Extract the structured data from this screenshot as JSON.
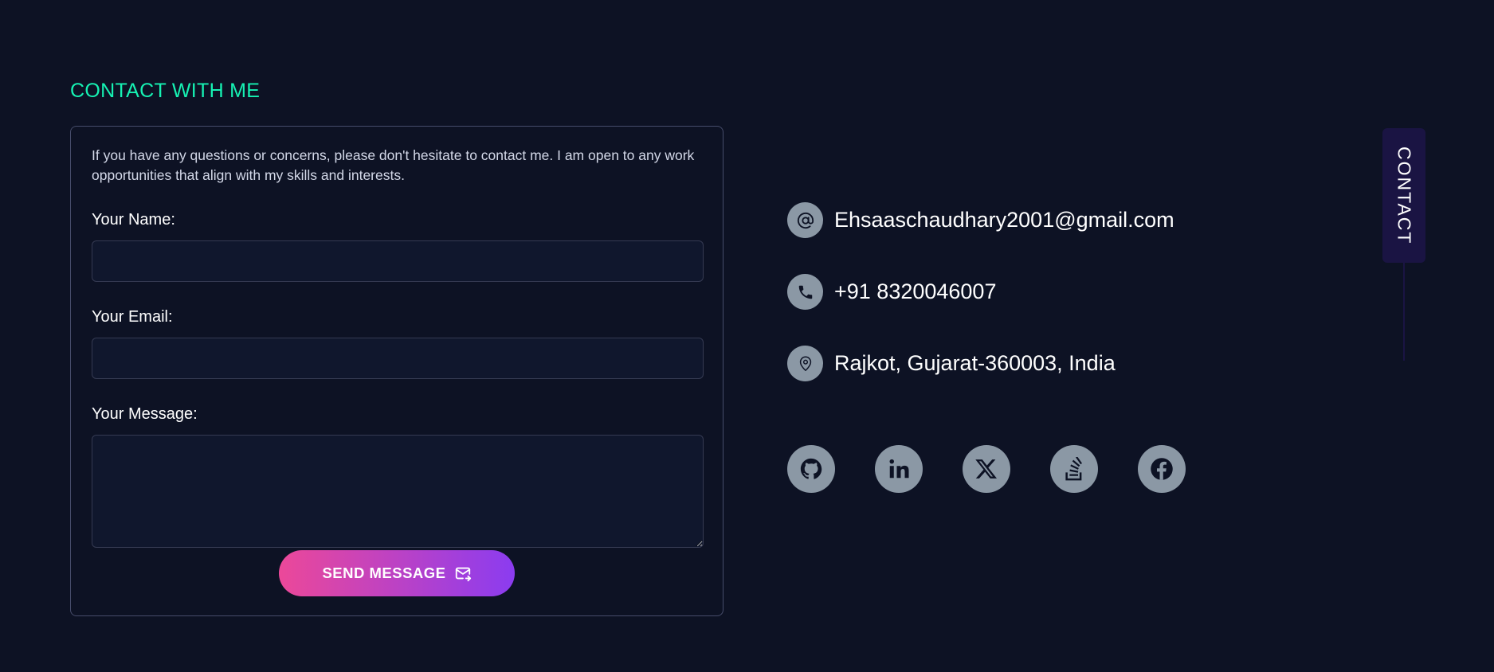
{
  "section": {
    "title": "CONTACT WITH ME"
  },
  "form": {
    "intro": "If you have any questions or concerns, please don't hesitate to contact me. I am open to any work opportunities that align with my skills and interests.",
    "name_label": "Your Name:",
    "name_value": "",
    "email_label": "Your Email:",
    "email_value": "",
    "message_label": "Your Message:",
    "message_value": "",
    "submit_label": "SEND MESSAGE",
    "submit_icon": "mail-send-icon",
    "submit_gradient": [
      "#ec4899",
      "#8b3cf0"
    ]
  },
  "contact_info": [
    {
      "icon": "at-sign-icon",
      "text": "Ehsaaschaudhary2001@gmail.com"
    },
    {
      "icon": "phone-icon",
      "text": "+91 8320046007"
    },
    {
      "icon": "location-pin-icon",
      "text": "Rajkot, Gujarat-360003, India"
    }
  ],
  "social_links": [
    {
      "icon": "github-icon"
    },
    {
      "icon": "linkedin-icon"
    },
    {
      "icon": "x-twitter-icon"
    },
    {
      "icon": "stackoverflow-icon"
    },
    {
      "icon": "facebook-icon"
    }
  ],
  "side_tab": {
    "label": "CONTACT"
  },
  "colors": {
    "background": "#0d1224",
    "accent_title": "#16f2b3",
    "icon_circle": "#8b98a5",
    "icon_glyph": "#0d1224",
    "side_tab": "#1a1443"
  }
}
